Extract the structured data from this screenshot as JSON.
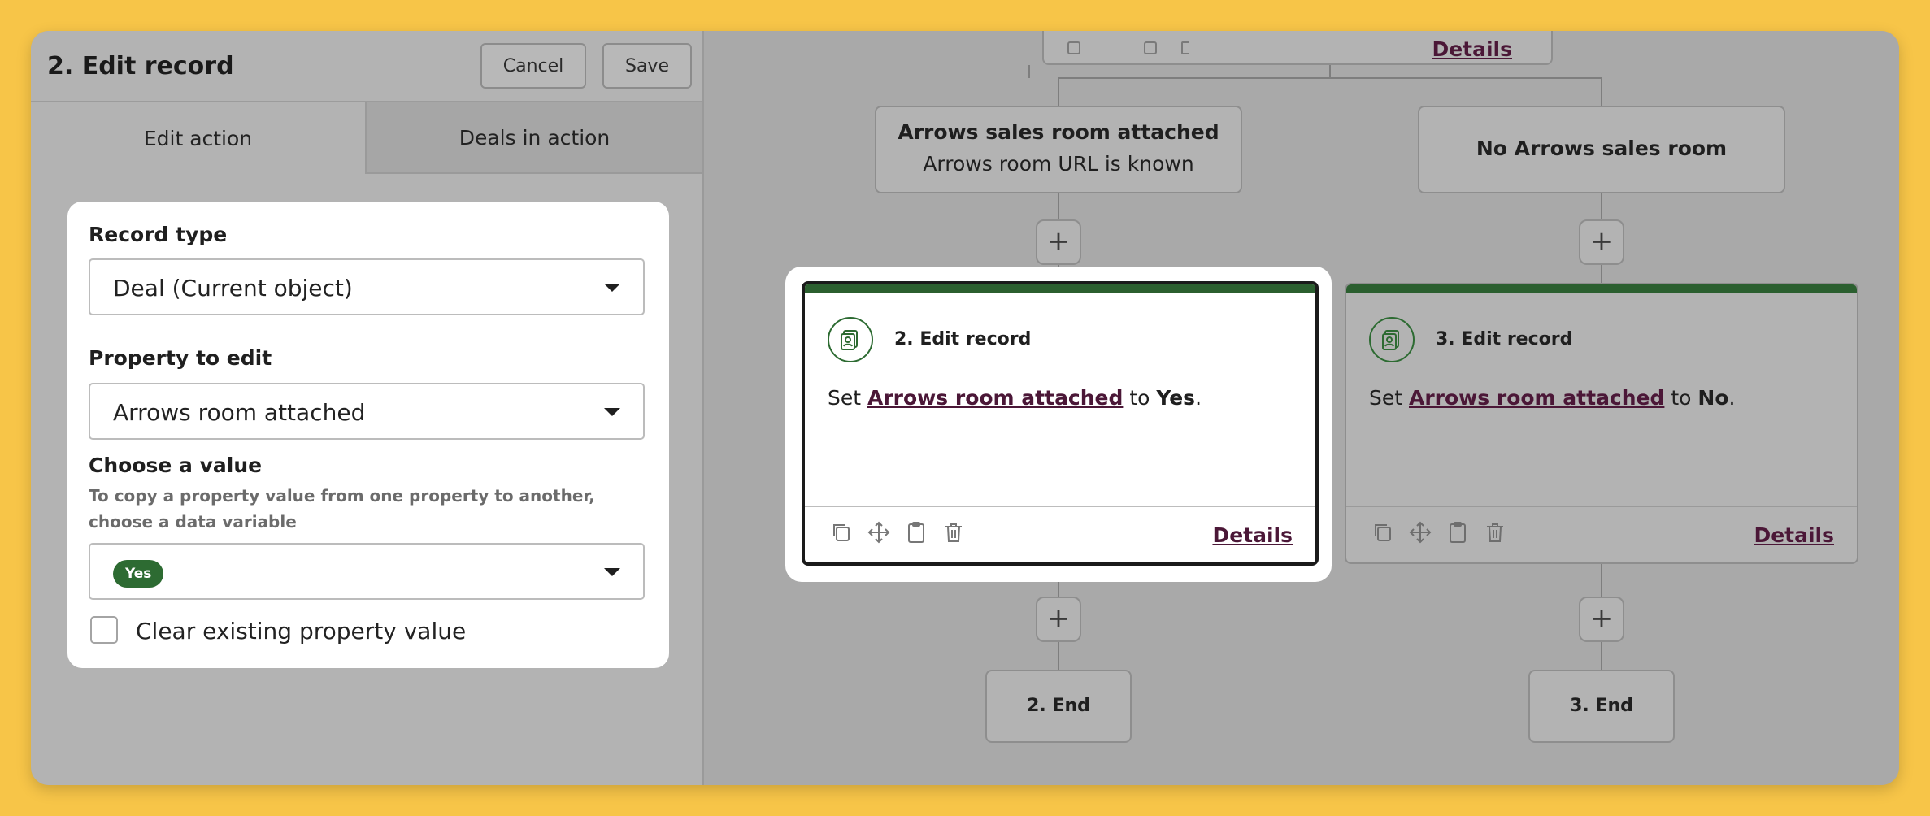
{
  "panel": {
    "title": "2. Edit record",
    "cancel_label": "Cancel",
    "save_label": "Save",
    "tabs": [
      {
        "label": "Edit action",
        "active": true
      },
      {
        "label": "Deals in action",
        "active": false
      }
    ],
    "form": {
      "record_type_label": "Record type",
      "record_type_value": "Deal (Current object)",
      "property_label": "Property to edit",
      "property_value": "Arrows room attached",
      "value_label": "Choose a value",
      "value_help": "To copy a property value from one property to another, choose a data variable",
      "value_pill": "Yes",
      "clear_label": "Clear existing property value",
      "clear_checked": false
    }
  },
  "canvas": {
    "top_card_details": "Details",
    "branch_left": {
      "title": "Arrows sales room attached",
      "subtitle": "Arrows room URL is known"
    },
    "branch_right": {
      "title": "No Arrows sales room"
    },
    "plus_label": "+",
    "card_left": {
      "title": "2. Edit record",
      "body_prefix": "Set ",
      "property": "Arrows room attached",
      "body_mid": " to ",
      "value": "Yes",
      "body_suffix": ".",
      "details": "Details",
      "selected": true
    },
    "card_right": {
      "title": "3. Edit record",
      "body_prefix": "Set ",
      "property": "Arrows room attached",
      "body_mid": " to ",
      "value": "No",
      "body_suffix": ".",
      "details": "Details",
      "selected": false
    },
    "end_left": "2. End",
    "end_right": "3. End"
  },
  "colors": {
    "background": "#f7c548",
    "accent_green": "#2b5f2f",
    "link": "#4b1737",
    "overlay_gray": "#a9a9a9"
  },
  "icons": [
    "copy-icon",
    "move-icon",
    "clipboard-icon",
    "trash-icon",
    "record-icon",
    "chevron-down-icon",
    "plus-icon"
  ]
}
